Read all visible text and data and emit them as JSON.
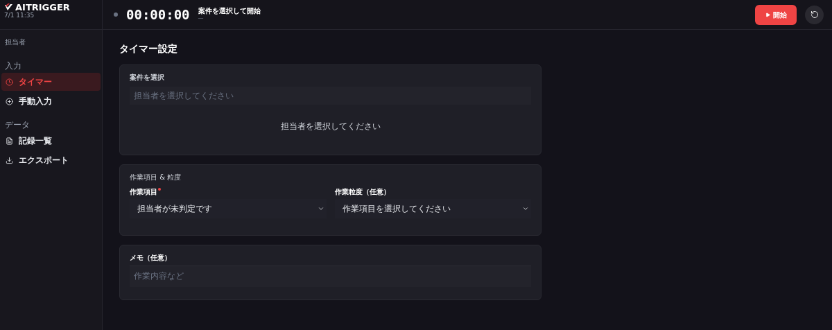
{
  "brand": {
    "name": "AITRIGGER",
    "datetime": "7/1 11:35"
  },
  "header": {
    "timer": "00:00:00",
    "title": "案件を選択して開始",
    "subtitle": "—",
    "start_button": "開始",
    "running": false
  },
  "sidebar": {
    "assignee_label": "担当者",
    "groups": [
      {
        "label": "入力",
        "items": [
          {
            "label": "タイマー",
            "selected": true
          },
          {
            "label": "手動入力",
            "selected": false
          }
        ]
      },
      {
        "label": "データ",
        "items": [
          {
            "label": "記録一覧",
            "selected": false
          },
          {
            "label": "エクスポート",
            "selected": false
          }
        ]
      }
    ]
  },
  "page_title": "タイマー設定",
  "project": {
    "label": "案件を選択",
    "search_placeholder": "担当者を選択してください",
    "empty_message": "担当者を選択してください"
  },
  "task": {
    "label": "作業項目 & 粒度",
    "fields": [
      {
        "label": "作業項目",
        "required": true,
        "value": "担当者が未判定です"
      },
      {
        "label": "作業粒度（任意）",
        "required": false,
        "value": "作業項目を選択してください"
      }
    ]
  },
  "memo": {
    "label": "メモ（任意）",
    "placeholder": "作業内容など"
  }
}
